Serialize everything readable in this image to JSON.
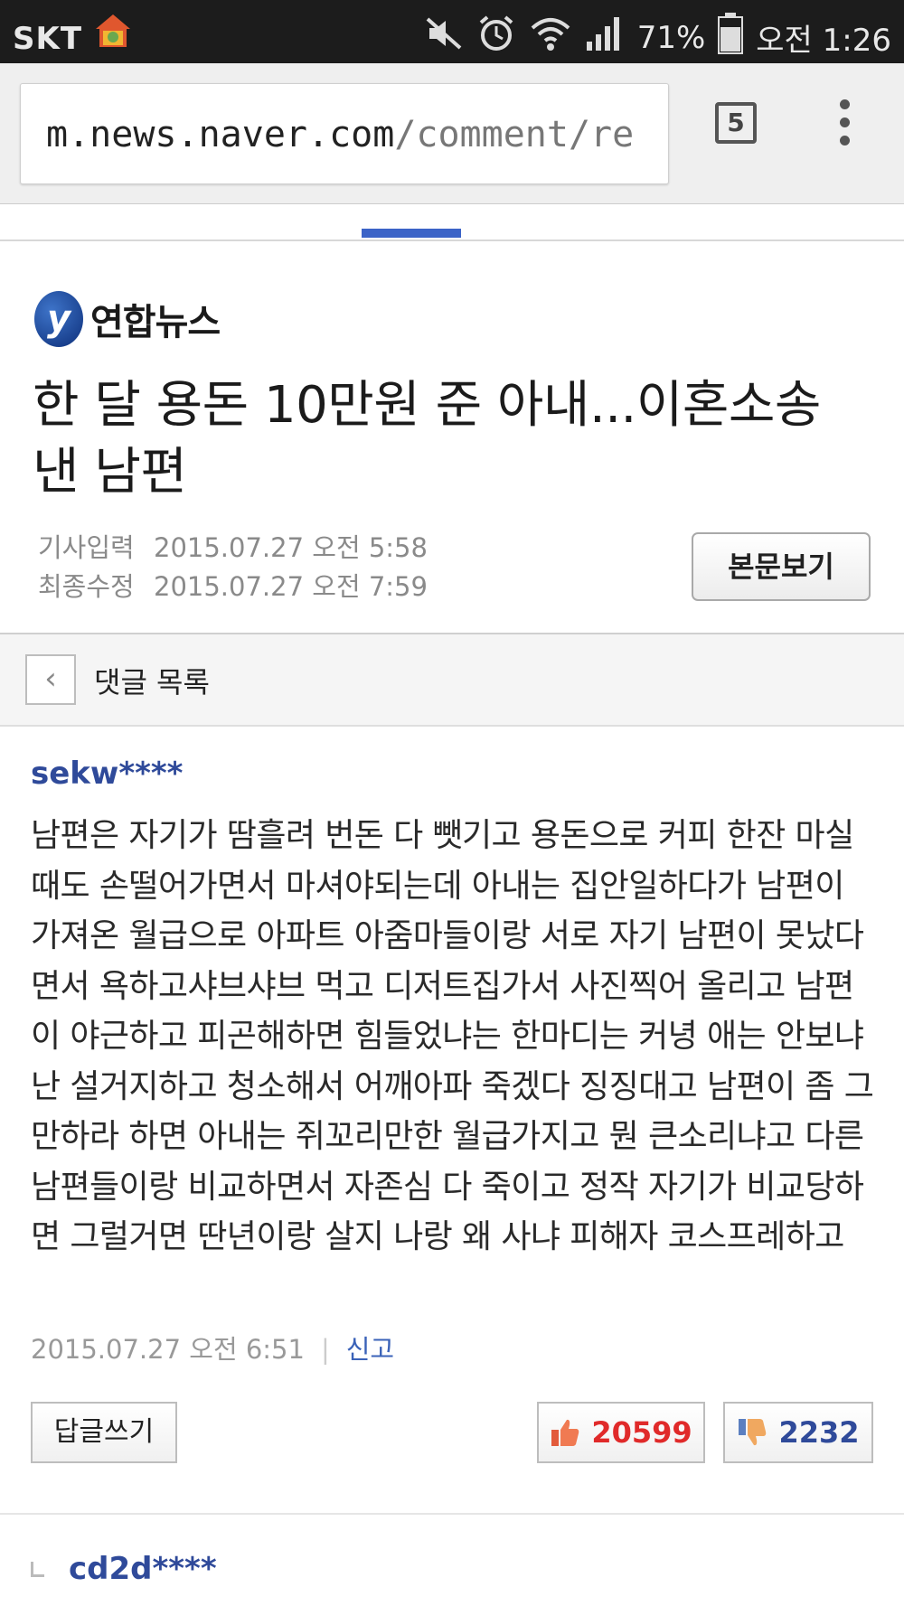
{
  "status_bar": {
    "carrier": "SKT",
    "battery": "71%",
    "time": "오전 1:26"
  },
  "browser": {
    "url_host": "m.news.naver.com",
    "url_path": "/comment/re",
    "tab_count": "5"
  },
  "article": {
    "source": "연합뉴스",
    "title": "한 달 용돈 10만원 준 아내...이혼소송 낸 남편",
    "published_label": "기사입력",
    "published": "2015.07.27 오전 5:58",
    "modified_label": "최종수정",
    "modified": "2015.07.27 오전 7:59",
    "view_button": "본문보기"
  },
  "comment_list": {
    "header": "댓글 목록"
  },
  "comments": [
    {
      "author": "sekw****",
      "text": "남편은 자기가 땀흘려 번돈 다 뺏기고 용돈으로 커피 한잔 마실때도 손떨어가면서 마셔야되는데 아내는 집안일하다가 남편이 가져온 월급으로 아파트 아줌마들이랑 서로 자기 남편이 못났다면서 욕하고샤브샤브 먹고 디저트집가서 사진찍어 올리고 남편이 야근하고 피곤해하면 힘들었냐는 한마디는 커녕 애는 안보냐 난 설거지하고 청소해서 어깨아파 죽겠다 징징대고 남편이 좀 그만하라 하면 아내는 쥐꼬리만한 월급가지고 뭔 큰소리냐고 다른 남편들이랑 비교하면서 자존심 다 죽이고 정작 자기가 비교당하면 그럴거면 딴년이랑 살지 나랑 왜 사냐 피해자 코스프레하고",
      "date": "2015.07.27 오전 6:51",
      "report": "신고",
      "reply_button": "답글쓰기",
      "likes": "20599",
      "dislikes": "2232"
    },
    {
      "author": "cd2d****"
    }
  ]
}
